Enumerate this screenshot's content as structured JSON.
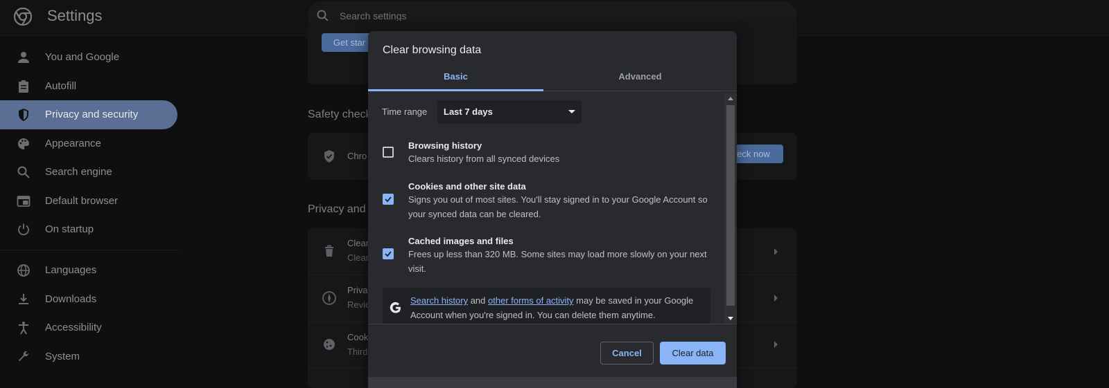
{
  "header": {
    "title": "Settings",
    "search_placeholder": "Search settings"
  },
  "sidebar": {
    "items": [
      {
        "label": "You and Google",
        "icon": "person-icon"
      },
      {
        "label": "Autofill",
        "icon": "clipboard-icon"
      },
      {
        "label": "Privacy and security",
        "icon": "shield-icon",
        "active": true
      },
      {
        "label": "Appearance",
        "icon": "palette-icon"
      },
      {
        "label": "Search engine",
        "icon": "search-icon"
      },
      {
        "label": "Default browser",
        "icon": "browser-window-icon"
      },
      {
        "label": "On startup",
        "icon": "power-icon"
      },
      {
        "label": "Languages",
        "icon": "globe-icon"
      },
      {
        "label": "Downloads",
        "icon": "download-icon"
      },
      {
        "label": "Accessibility",
        "icon": "accessibility-icon"
      },
      {
        "label": "System",
        "icon": "wrench-icon"
      }
    ]
  },
  "background": {
    "get_started_fragment": "Get star",
    "safety_check_fragment": "Safety check",
    "safety_row_fragment": "Chro",
    "check_now_fragment": "eck now",
    "privacy_heading_fragment": "Privacy and s",
    "rows": [
      {
        "title": "Clear",
        "sub": "Clear"
      },
      {
        "title": "Priva",
        "sub": "Revie"
      },
      {
        "title": "Cook",
        "sub": "Third"
      }
    ]
  },
  "dialog": {
    "title": "Clear browsing data",
    "tabs": [
      "Basic",
      "Advanced"
    ],
    "time_range_label": "Time range",
    "time_range_value": "Last 7 days",
    "options": [
      {
        "title": "Browsing history",
        "desc": "Clears history from all synced devices",
        "checked": false
      },
      {
        "title": "Cookies and other site data",
        "desc": "Signs you out of most sites. You'll stay signed in to your Google Account so your synced data can be cleared.",
        "checked": true
      },
      {
        "title": "Cached images and files",
        "desc": "Frees up less than 320 MB. Some sites may load more slowly on your next visit.",
        "checked": true
      }
    ],
    "info": {
      "link1": "Search history",
      "mid": " and ",
      "link2": "other forms of activity",
      "rest": " may be saved in your Google Account when you're signed in. You can delete them anytime."
    },
    "cancel_label": "Cancel",
    "clear_label": "Clear data"
  },
  "colors": {
    "accent": "#8ab4f8",
    "active_nav": "#5a6f93",
    "dialog_bg": "#292a2d"
  }
}
